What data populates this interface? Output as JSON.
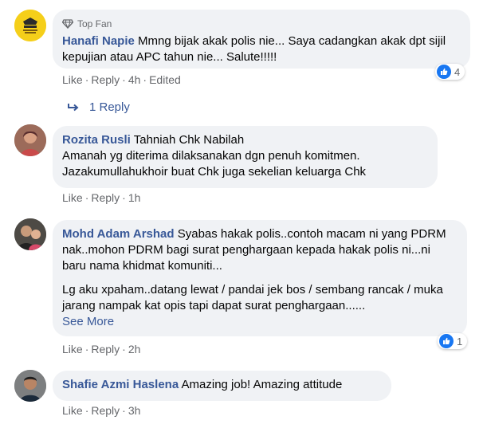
{
  "comments": [
    {
      "badge": "Top Fan",
      "name": "Hanafi Napie",
      "text": "Mmng bijak akak polis nie... Saya cadangkan akak dpt sijil kepujian atau APC tahun nie... Salute!!!!!",
      "like": "Like",
      "reply": "Reply",
      "time": "4h",
      "edited": "Edited",
      "reactions": "4",
      "replies_link": "1 Reply"
    },
    {
      "name": "Rozita Rusli",
      "text_lines": [
        "Tahniah Chk Nabilah",
        "Amanah yg diterima dilaksanakan dgn penuh komitmen.",
        "Jazakumullahukhoir buat Chk juga sekelian keluarga Chk"
      ],
      "like": "Like",
      "reply": "Reply",
      "time": "1h"
    },
    {
      "name": "Mohd Adam Arshad",
      "text": "Syabas hakak polis..contoh macam ni yang PDRM nak..mohon PDRM bagi surat penghargaan kepada hakak polis ni...ni baru nama khidmat komuniti...",
      "text2": "Lg aku xpaham..datang lewat / pandai jek bos / sembang rancak / muka jarang nampak kat opis tapi dapat surat penghargaan......",
      "see_more": "See More",
      "like": "Like",
      "reply": "Reply",
      "time": "2h",
      "reactions": "1"
    },
    {
      "name": "Shafie Azmi Haslena",
      "text": "Amazing job! Amazing attitude",
      "like": "Like",
      "reply": "Reply",
      "time": "3h"
    }
  ],
  "colors": {
    "name_link": "#385898",
    "bubble_bg": "#f0f2f5",
    "meta_text": "#65676b",
    "like_blue": "#1877f2"
  }
}
